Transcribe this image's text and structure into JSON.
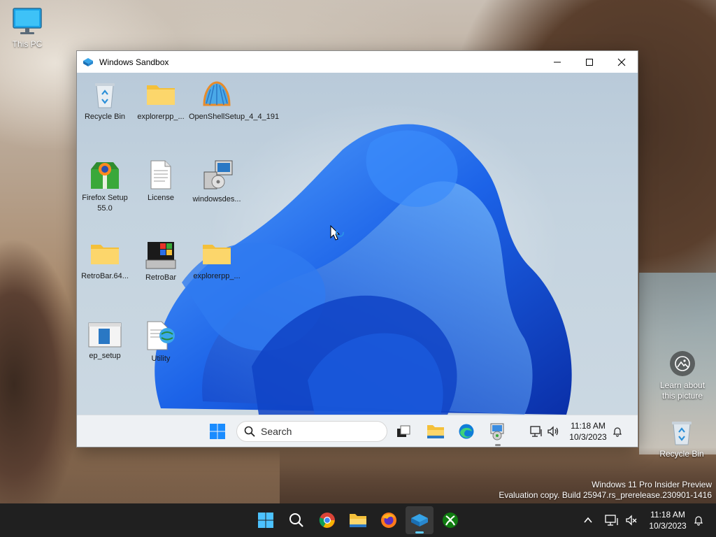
{
  "host_desktop": {
    "icons": [
      {
        "label": "This PC"
      },
      {
        "label": "Recycle Bin"
      }
    ],
    "learn_label_line1": "Learn about",
    "learn_label_line2": "this picture",
    "watermark_line1": "Windows 11 Pro Insider Preview",
    "watermark_line2": "Evaluation copy. Build 25947.rs_prerelease.230901-1416"
  },
  "sandbox": {
    "title": "Windows Sandbox",
    "icons": [
      {
        "label": "Recycle Bin"
      },
      {
        "label": "explorerpp_..."
      },
      {
        "label": "OpenShellSetup_4_4_191"
      },
      {
        "label": "Firefox Setup 55.0"
      },
      {
        "label": "License"
      },
      {
        "label": "windowsdes..."
      },
      {
        "label": "RetroBar.64..."
      },
      {
        "label": "RetroBar"
      },
      {
        "label": "explorerpp_..."
      },
      {
        "label": "ep_setup"
      },
      {
        "label": "Utility"
      }
    ],
    "taskbar": {
      "search_placeholder": "Search",
      "time": "11:18 AM",
      "date": "10/3/2023"
    }
  },
  "host_taskbar": {
    "time": "11:18 AM",
    "date": "10/3/2023"
  },
  "colors": {
    "accent": "#0078d4",
    "taskbar_bg": "#202020",
    "indicator": "#60cdff"
  }
}
